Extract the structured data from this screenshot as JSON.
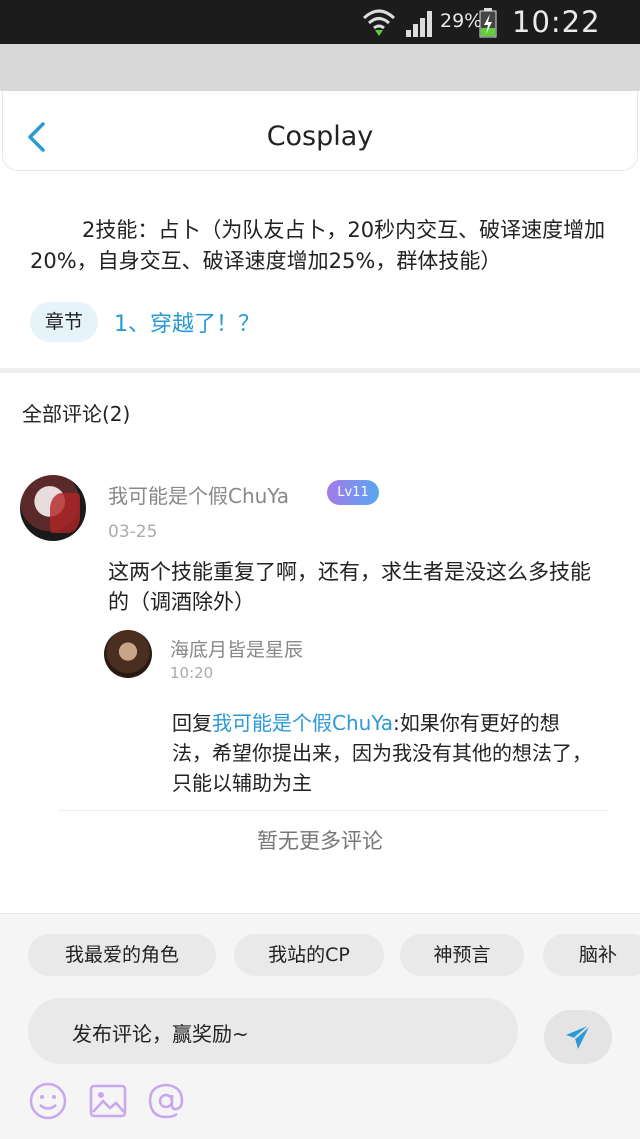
{
  "status": {
    "battery": "29%",
    "time": "10:22 AM"
  },
  "header": {
    "title": "Cosplay",
    "back_icon": "chevron-left-icon"
  },
  "content": {
    "text": "2技能：占卜（为队友占卜，20秒内交互、破译速度增加20%，自身交互、破译速度增加25%，群体技能）",
    "chapter_label": "章节",
    "chapter_link": "1、穿越了！？"
  },
  "comments_section": {
    "heading": "全部评论(2)",
    "comment1": {
      "author": "我可能是个假ChuYa",
      "level": "Lv11",
      "date": "03-25",
      "body": "这两个技能重复了啊，还有，求生者是没这么多技能的（调酒除外）"
    },
    "reply1": {
      "author": "海底月皆是星辰",
      "time": "10:20",
      "prefix": "回复",
      "target": "我可能是个假ChuYa",
      "body": ":如果你有更好的想法，希望你提出来，因为我没有其他的想法了，只能以辅助为主"
    },
    "no_more": "暂无更多评论"
  },
  "composer": {
    "tags": [
      "我最爱的角色",
      "我站的CP",
      "神预言",
      "脑补"
    ],
    "placeholder": "发布评论，赢奖励~",
    "send_icon": "send-icon",
    "tools": [
      "emoji-icon",
      "image-icon",
      "mention-icon"
    ],
    "accent": "#2a9ad6",
    "tool_color": "#c9a6ef"
  }
}
